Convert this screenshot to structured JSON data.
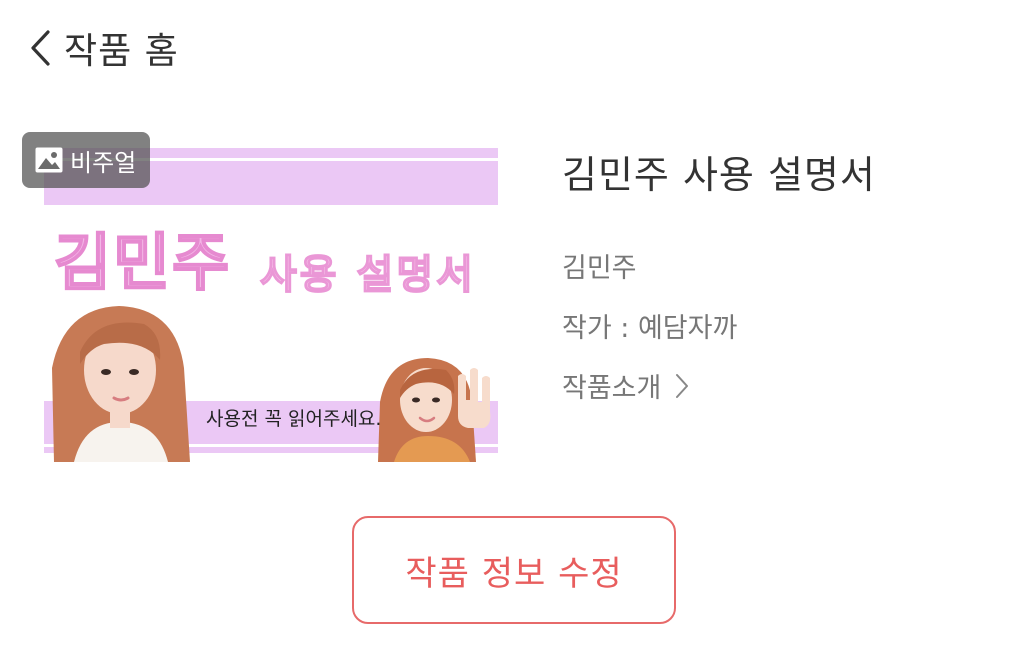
{
  "header": {
    "back_icon": "chevron-left-icon",
    "title": "작품 홈"
  },
  "cover": {
    "badge_icon": "image-icon",
    "badge_label": "비주얼",
    "title_part1": "김민주",
    "title_part2": "사용 설명서",
    "subtitle": "사용전 꼭 읽어주세요.",
    "band_color": "#ebc8f5"
  },
  "work": {
    "title": "김민주 사용 설명서",
    "name": "김민주",
    "author": "작가 : 예담자까",
    "intro_label": "작품소개",
    "intro_icon": "chevron-right-icon"
  },
  "actions": {
    "edit_label": "작품 정보 수정",
    "accent_color": "#e85d5d"
  }
}
